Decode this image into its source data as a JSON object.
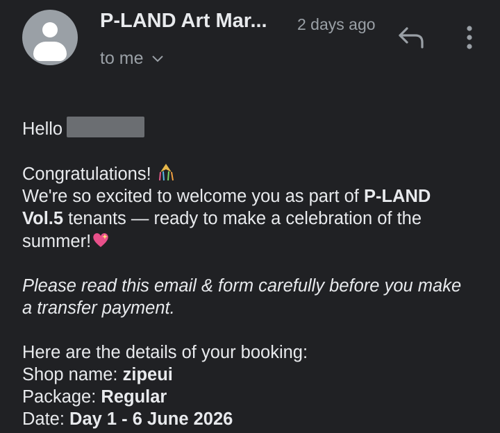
{
  "header": {
    "sender": "P-LAND Art Mar...",
    "time": "2 days ago",
    "recipient": "to me",
    "icons": {
      "avatar": "person-avatar-icon",
      "recipient_toggle": "chevron-down-icon",
      "reply": "reply-icon",
      "more": "more-vertical-icon"
    }
  },
  "email": {
    "greeting": "Hello",
    "congrats": "Congratulations!",
    "welcome_prefix": "We're so excited to welcome you as part of ",
    "welcome_bold": "P-LAND Vol.5",
    "welcome_suffix": " tenants — ready to make a celebration of the summer!",
    "notice": "Please read this email & form carefully before you make a transfer payment.",
    "details_intro": "Here are the details of your booking:",
    "shop_label": "Shop name: ",
    "shop_value": "zipeui",
    "package_label": "Package: ",
    "package_value": "Regular",
    "date_label": "Date: ",
    "date_value": "Day 1 - 6 June 2026"
  },
  "colors": {
    "background": "#202124",
    "text": "#e8eaed",
    "secondary_text": "#9aa0a6",
    "avatar": "#9aa0a6"
  }
}
